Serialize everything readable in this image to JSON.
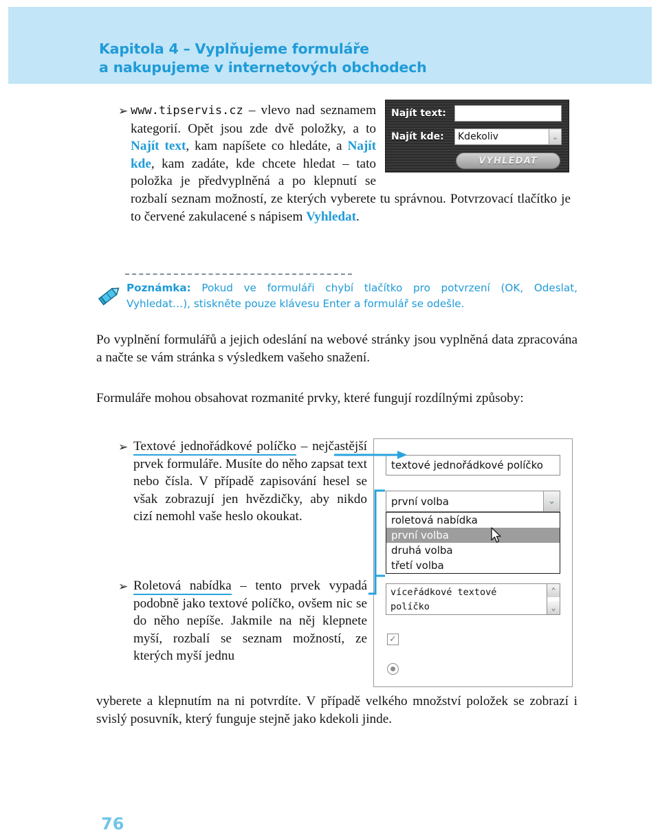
{
  "page": {
    "number": "76",
    "accent_blue": "#1f9bd8",
    "band_blue": "#c2e5f7",
    "underline_blue": "#29a3dd"
  },
  "header": {
    "line1": "Kapitola 4 – Vyplňujeme formuláře",
    "line2": "a nakupujeme v internetových obchodech"
  },
  "intro": {
    "bullet_glyph": "➢",
    "text_part1": "www.tipservis.cz",
    "text_part2": " – vlevo nad seznamem kategorií. Opět jsou zde dvě položky, a to ",
    "bold1": "Najít text",
    "text_part3": ", kam napíšete co hledáte, a ",
    "bold2": "Najít kde",
    "text_part4": ", kam zadáte, kde chcete hledat – tato položka je předvyplněná a po klepnutí se rozbalí seznam možností, ze kterých vyberete tu správnou. Potvrzovací tlačítko je to červené zakulacené s nápisem ",
    "bold3": "Vyhledat",
    "text_part5": "."
  },
  "search_widget": {
    "label_text": "Najít text:",
    "label_where": "Najít kde:",
    "text_value": "",
    "where_value": "Kdekoliv",
    "where_options": [
      "Kdekoliv"
    ],
    "button_label": "VYHLEDAT",
    "dropdown_glyph": "⌄"
  },
  "note": {
    "icon": "pencil-icon",
    "label": "Poznámka:",
    "body": " Pokud ve formuláři chybí tlačítko pro potvrzení (OK, Odeslat, Vyhledat…), stiskněte pouze klávesu Enter a formulář se odešle."
  },
  "paragraphs": {
    "po_vyplneni": "Po vyplnění formulářů a jejich odeslání na webové stránky jsou vyplněná data zpracována a načte se vám stránka s výsledkem vašeho snažení.",
    "formulare": "Formuláře mohou obsahovat rozmanité prvky, které fungují rozdílnými způsoby:",
    "tail": "vyberete a klepnutím na ni potvrdíte. V případě velkého množství položek se zobrazí i svislý posuvník, který funguje stejně jako kdekoli jinde."
  },
  "bullets": {
    "glyph": "➢",
    "item1_head": "Textové jednořádkové políčko",
    "item1_body": " – nejčastější prvek formuláře. Musíte do něho zapsat text nebo čísla. V případě zapisování hesel se však zobrazují jen hvězdičky, aby nikdo cizí nemohl vaše heslo okoukat.",
    "item2_head": "Roletová nabídka",
    "item2_body": " – tento prvek vypadá podobně jako textové políčko, ovšem nic se do něho nepíše. Jakmile na něj klepnete myší, rozbalí se seznam možností, ze kterých myší jednu"
  },
  "form_diagram": {
    "text_input_value": "textové jednořádkové políčko",
    "select_value": "první volba",
    "select_arrow_glyph": "⌄",
    "listbox_options": [
      {
        "label": "roletová nabídka",
        "selected": false
      },
      {
        "label": "první volba",
        "selected": true
      },
      {
        "label": "druhá volba",
        "selected": false
      },
      {
        "label": "třetí volba",
        "selected": false
      }
    ],
    "textarea_line1": "víceřádkové textové",
    "textarea_line2": "políčko",
    "scroll_up_glyph": "⌃",
    "scroll_down_glyph": "⌄",
    "checkbox_glyph": "✓",
    "checkbox_checked": true,
    "radio_checked": true,
    "cursor": "mouse-pointer-icon"
  }
}
